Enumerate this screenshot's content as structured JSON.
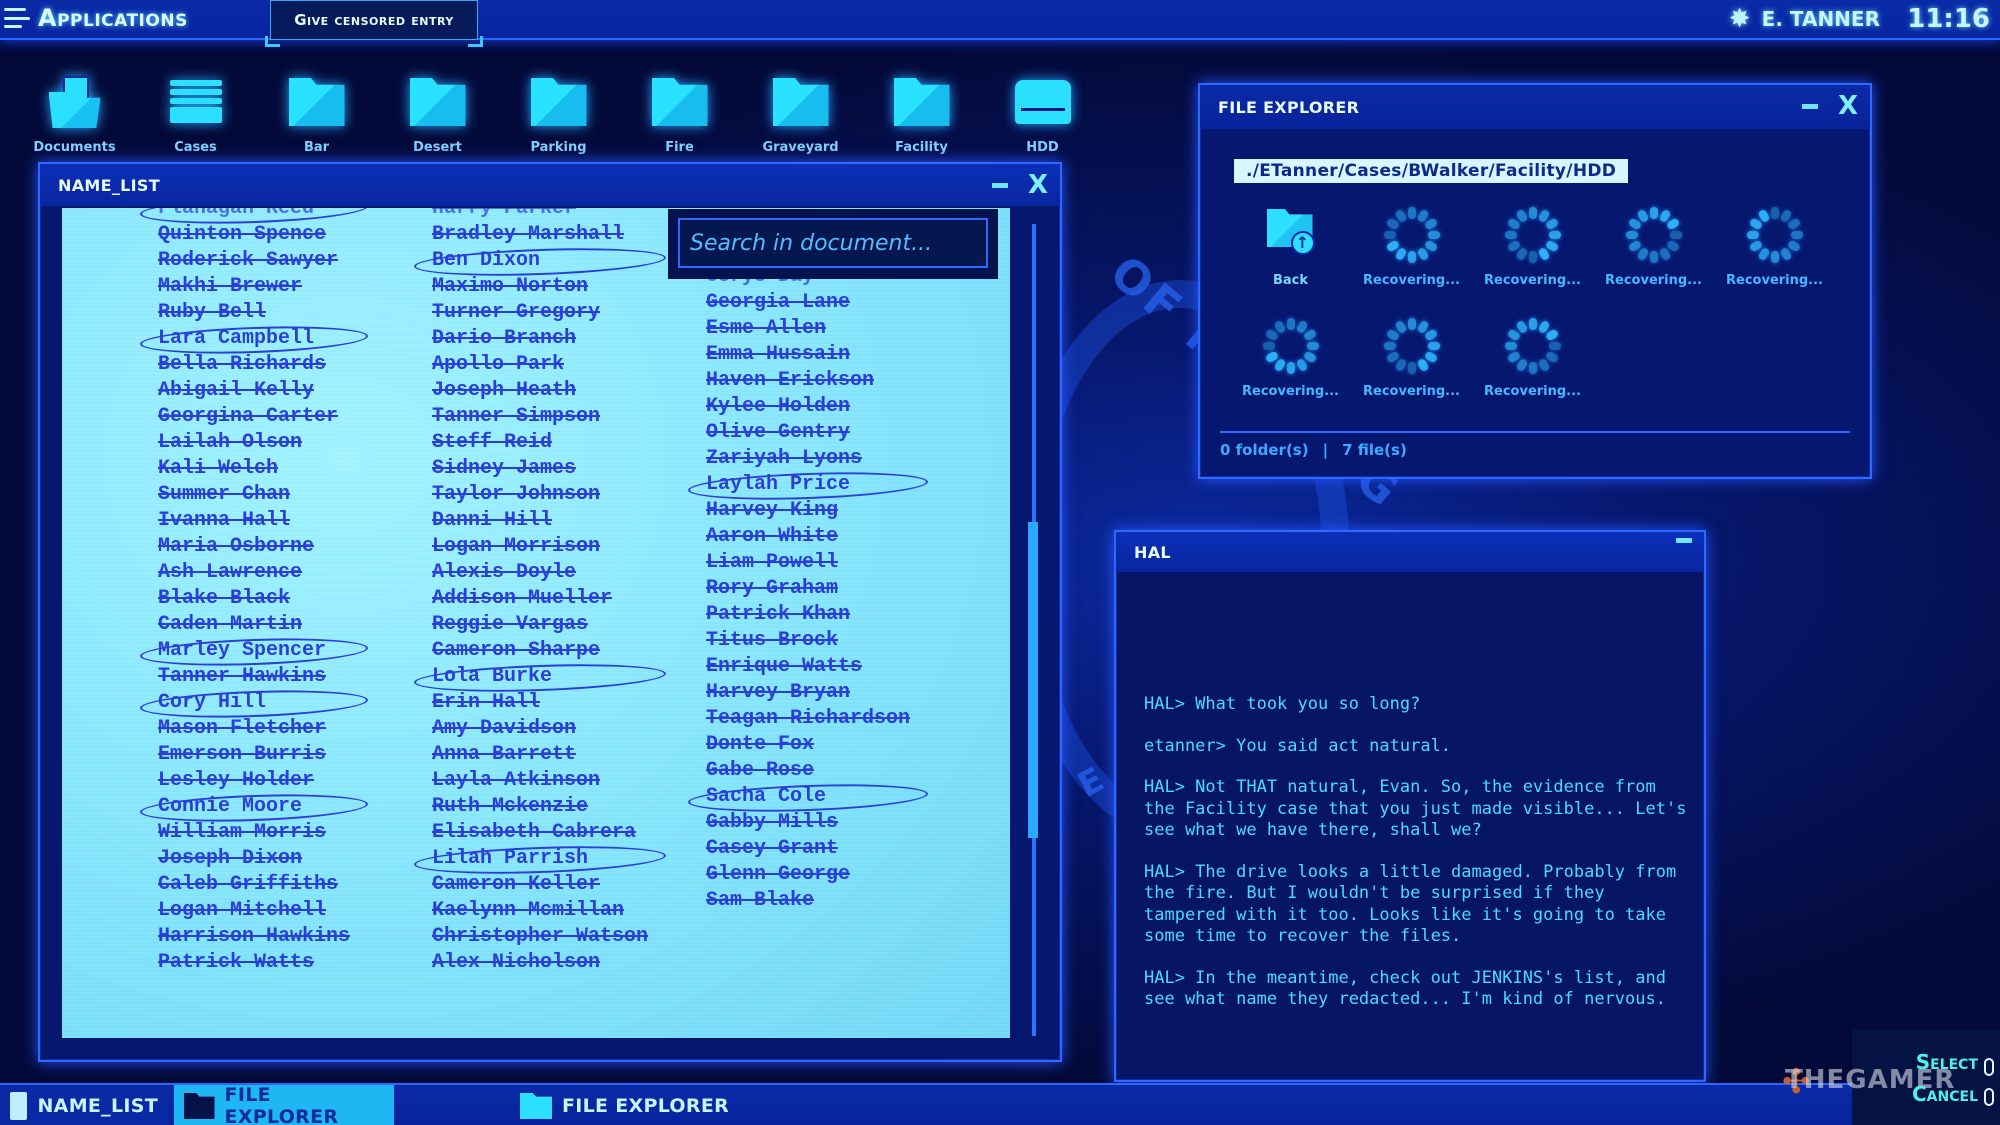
{
  "topbar": {
    "apps_label": "Applications",
    "censor_button": "Give censored entry",
    "user_name": "E. TANNER",
    "clock": "11:16"
  },
  "desktop_icons": [
    {
      "label": "Documents",
      "icon": "documents-folder-icon"
    },
    {
      "label": "Cases",
      "icon": "file-cabinet-icon"
    },
    {
      "label": "Bar",
      "icon": "folder-icon"
    },
    {
      "label": "Desert",
      "icon": "folder-icon"
    },
    {
      "label": "Parking",
      "icon": "folder-icon"
    },
    {
      "label": "Fire",
      "icon": "folder-icon"
    },
    {
      "label": "Graveyard",
      "icon": "folder-icon"
    },
    {
      "label": "Facility",
      "icon": "folder-icon"
    },
    {
      "label": "HDD",
      "icon": "hard-drive-icon"
    }
  ],
  "name_list": {
    "title": "NAME_LIST",
    "search_placeholder": "Search in document...",
    "scroll_position": 0.6,
    "columns": [
      [
        {
          "name": "Flanagan Reed",
          "state": "partial-circled"
        },
        {
          "name": "Quinton Spence",
          "state": "struck"
        },
        {
          "name": "Roderick Sawyer",
          "state": "struck"
        },
        {
          "name": "Makhi Brewer",
          "state": "struck"
        },
        {
          "name": "Ruby Bell",
          "state": "struck"
        },
        {
          "name": "Lara Campbell",
          "state": "circled"
        },
        {
          "name": "Bella Richards",
          "state": "struck"
        },
        {
          "name": "Abigail Kelly",
          "state": "struck"
        },
        {
          "name": "Georgina Carter",
          "state": "struck"
        },
        {
          "name": "Lailah Olson",
          "state": "struck"
        },
        {
          "name": "Kali Welch",
          "state": "struck"
        },
        {
          "name": "Summer Chan",
          "state": "struck"
        },
        {
          "name": "Ivanna Hall",
          "state": "struck"
        },
        {
          "name": "Maria Osborne",
          "state": "struck"
        },
        {
          "name": "Ash Lawrence",
          "state": "struck"
        },
        {
          "name": "Blake Black",
          "state": "struck"
        },
        {
          "name": "Caden Martin",
          "state": "struck"
        },
        {
          "name": "Marley Spencer",
          "state": "circled"
        },
        {
          "name": "Tanner Hawkins",
          "state": "struck"
        },
        {
          "name": "Cory Hill",
          "state": "circled"
        },
        {
          "name": "Mason Fletcher",
          "state": "struck"
        },
        {
          "name": "Emerson Burris",
          "state": "struck"
        },
        {
          "name": "Lesley Holder",
          "state": "struck"
        },
        {
          "name": "Connie Moore",
          "state": "circled"
        },
        {
          "name": "William Morris",
          "state": "struck"
        },
        {
          "name": "Joseph Dixon",
          "state": "struck"
        },
        {
          "name": "Caleb Griffiths",
          "state": "struck"
        },
        {
          "name": "Logan Mitchell",
          "state": "struck"
        },
        {
          "name": "Harrison Hawkins",
          "state": "struck"
        },
        {
          "name": "Patrick Watts",
          "state": "struck"
        }
      ],
      [
        {
          "name": "Harry Parker",
          "state": "partial-struck"
        },
        {
          "name": "Bradley Marshall",
          "state": "struck"
        },
        {
          "name": "Ben Dixon",
          "state": "circled"
        },
        {
          "name": "Maximo Norton",
          "state": "struck"
        },
        {
          "name": "Turner Gregory",
          "state": "struck"
        },
        {
          "name": "Dario Branch",
          "state": "struck"
        },
        {
          "name": "Apollo Park",
          "state": "struck"
        },
        {
          "name": "Joseph Heath",
          "state": "struck"
        },
        {
          "name": "Tanner Simpson",
          "state": "struck"
        },
        {
          "name": "Steff Reid",
          "state": "struck"
        },
        {
          "name": "Sidney James",
          "state": "struck"
        },
        {
          "name": "Taylor Johnson",
          "state": "struck"
        },
        {
          "name": "Danni Hill",
          "state": "struck"
        },
        {
          "name": "Logan Morrison",
          "state": "struck"
        },
        {
          "name": "Alexis Doyle",
          "state": "struck"
        },
        {
          "name": "Addison Mueller",
          "state": "struck"
        },
        {
          "name": "Reggie Vargas",
          "state": "struck"
        },
        {
          "name": "Cameron Sharpe",
          "state": "struck"
        },
        {
          "name": "Lola Burke",
          "state": "circled"
        },
        {
          "name": "Erin Hall",
          "state": "struck"
        },
        {
          "name": "Amy Davidson",
          "state": "struck"
        },
        {
          "name": "Anna Barrett",
          "state": "struck"
        },
        {
          "name": "Layla Atkinson",
          "state": "struck"
        },
        {
          "name": "Ruth Mckenzie",
          "state": "struck"
        },
        {
          "name": "Elisabeth Cabrera",
          "state": "struck"
        },
        {
          "name": "Lilah Parrish",
          "state": "circled"
        },
        {
          "name": "Cameron Keller",
          "state": "struck"
        },
        {
          "name": "Kaelynn Mcmillan",
          "state": "struck"
        },
        {
          "name": "Christopher Watson",
          "state": "struck"
        },
        {
          "name": "Alex Nicholson",
          "state": "struck"
        }
      ],
      [
        {
          "name": "Cerys Day",
          "state": "partial-struck"
        },
        {
          "name": "Georgia Lane",
          "state": "struck"
        },
        {
          "name": "Esme Allen",
          "state": "struck"
        },
        {
          "name": "Emma Hussain",
          "state": "struck"
        },
        {
          "name": "Haven Erickson",
          "state": "struck"
        },
        {
          "name": "Kylee Holden",
          "state": "struck"
        },
        {
          "name": "Olive Gentry",
          "state": "struck"
        },
        {
          "name": "Zariyah Lyons",
          "state": "struck"
        },
        {
          "name": "Laylah Price",
          "state": "circled"
        },
        {
          "name": "Harvey King",
          "state": "struck"
        },
        {
          "name": "Aaron White",
          "state": "struck"
        },
        {
          "name": "Liam Powell",
          "state": "struck"
        },
        {
          "name": "Rory Graham",
          "state": "struck"
        },
        {
          "name": "Patrick Khan",
          "state": "struck"
        },
        {
          "name": "Titus Brock",
          "state": "struck"
        },
        {
          "name": "Enrique Watts",
          "state": "struck"
        },
        {
          "name": "Harvey Bryan",
          "state": "struck"
        },
        {
          "name": "Teagan Richardson",
          "state": "struck"
        },
        {
          "name": "Donte Fox",
          "state": "struck"
        },
        {
          "name": "Gabe Rose",
          "state": "struck"
        },
        {
          "name": "Sacha Cole",
          "state": "selected-circled"
        },
        {
          "name": "Gabby Mills",
          "state": "struck"
        },
        {
          "name": "Casey Grant",
          "state": "struck"
        },
        {
          "name": "Glenn George",
          "state": "struck"
        },
        {
          "name": "Sam Blake",
          "state": "struck"
        }
      ]
    ]
  },
  "file_explorer": {
    "title": "FILE EXPLORER",
    "path": "./ETanner/Cases/BWalker/Facility/HDD",
    "items": [
      {
        "label": "Back",
        "type": "back"
      },
      {
        "label": "Recovering...",
        "type": "recovering"
      },
      {
        "label": "Recovering...",
        "type": "recovering"
      },
      {
        "label": "Recovering...",
        "type": "recovering"
      },
      {
        "label": "Recovering...",
        "type": "recovering"
      },
      {
        "label": "Recovering...",
        "type": "recovering"
      },
      {
        "label": "Recovering...",
        "type": "recovering"
      },
      {
        "label": "Recovering...",
        "type": "recovering"
      }
    ],
    "folder_count": "0 folder(s)",
    "separator": "|",
    "file_count": "7 file(s)"
  },
  "hal": {
    "title": "HAL",
    "messages": [
      "HAL> What took you so long?",
      "etanner> You said act natural.",
      "HAL> Not THAT natural, Evan. So, the evidence from the Facility case that you just made visible... Let's see what we have there, shall we?",
      "HAL> The drive looks a little damaged. Probably from the fire. But I wouldn't be surprised if they tampered with it too. Looks like it's going to take some time to recover the files.",
      "HAL> In the meantime, check out JENKINS's list, and see what name they redacted... I'm kind of nervous."
    ]
  },
  "taskbar": [
    {
      "label": "NAME_LIST",
      "icon": "document-icon",
      "active": false
    },
    {
      "label": "FILE EXPLORER",
      "icon": "folder-icon",
      "active": true
    },
    {
      "label": "FILE EXPLORER",
      "icon": "folder-icon",
      "active": false
    }
  ],
  "controls_hint": {
    "select": "Select",
    "cancel": "Cancel"
  },
  "watermark": "THEGAMER",
  "colors": {
    "background": "#030a3a",
    "window_border": "#2e68ff",
    "accent_cyan": "#2de0ff",
    "paper": "#8ceafd",
    "ink": "#2a3fd8",
    "terminal_text": "#48dcff"
  }
}
